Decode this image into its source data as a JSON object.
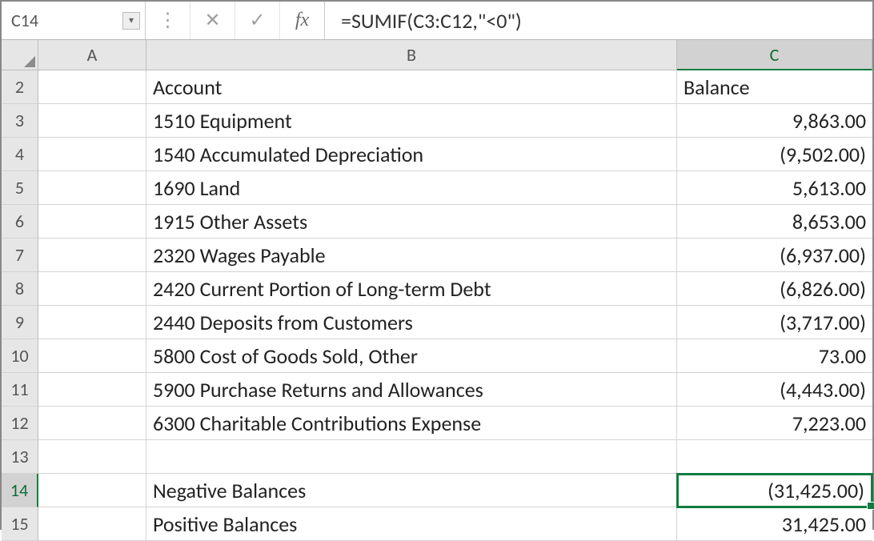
{
  "nameBox": "C14",
  "formula": "=SUMIF(C3:C12,\"<0\")",
  "columns": [
    "A",
    "B",
    "C"
  ],
  "headers": {
    "account": "Account",
    "balance": "Balance"
  },
  "rows": [
    {
      "n": "3",
      "account": "1510 Equipment",
      "balance": "9,863.00"
    },
    {
      "n": "4",
      "account": "1540 Accumulated Depreciation",
      "balance": "(9,502.00)"
    },
    {
      "n": "5",
      "account": "1690 Land",
      "balance": "5,613.00"
    },
    {
      "n": "6",
      "account": "1915 Other Assets",
      "balance": "8,653.00"
    },
    {
      "n": "7",
      "account": "2320 Wages Payable",
      "balance": "(6,937.00)"
    },
    {
      "n": "8",
      "account": "2420 Current Portion of Long-term Debt",
      "balance": "(6,826.00)"
    },
    {
      "n": "9",
      "account": "2440 Deposits from Customers",
      "balance": "(3,717.00)"
    },
    {
      "n": "10",
      "account": "5800 Cost of Goods Sold, Other",
      "balance": "73.00"
    },
    {
      "n": "11",
      "account": "5900 Purchase Returns and Allowances",
      "balance": "(4,443.00)"
    },
    {
      "n": "12",
      "account": "6300 Charitable Contributions Expense",
      "balance": "7,223.00"
    }
  ],
  "blankRow": "13",
  "summary": [
    {
      "n": "14",
      "label": "Negative Balances",
      "value": "(31,425.00)",
      "selected": true
    },
    {
      "n": "15",
      "label": "Positive Balances",
      "value": "31,425.00",
      "selected": false
    }
  ],
  "icons": {
    "dropdown": "▾",
    "dots": "⋮",
    "cancel": "✕",
    "enter": "✓",
    "fx": "fx"
  }
}
